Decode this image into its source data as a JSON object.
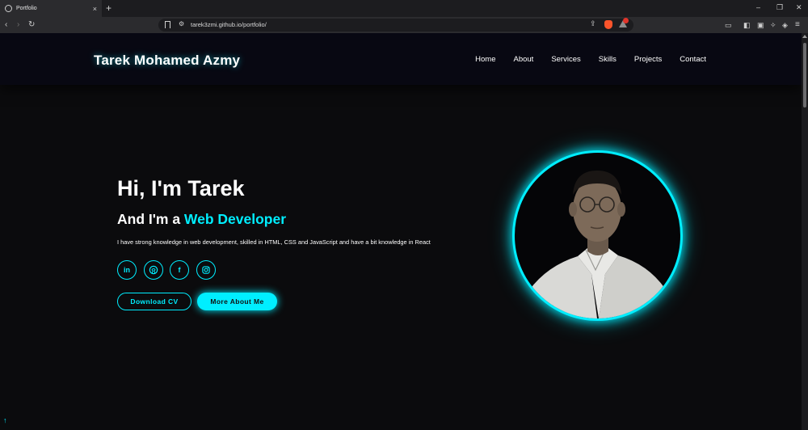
{
  "browser": {
    "tab_title": "Portfolio",
    "tab_close": "×",
    "new_tab": "+",
    "url": "tarek3zmi.github.io/portfolio/",
    "window_controls": [
      "–",
      "❐",
      "✕"
    ]
  },
  "header": {
    "logo": "Tarek Mohamed Azmy",
    "nav": [
      "Home",
      "About",
      "Services",
      "Skills",
      "Projects",
      "Contact"
    ]
  },
  "hero": {
    "greeting": "Hi, I'm Tarek",
    "role_prefix": "And I'm a ",
    "role": "Web Developer",
    "description": "I have strong knowledge in web development, skilled in HTML, CSS and JavaScript and have a bit knowledge in React",
    "socials": [
      "linkedin-icon",
      "github-icon",
      "facebook-icon",
      "instagram-icon"
    ],
    "buttons": {
      "cv": "Download CV",
      "about": "More About Me"
    }
  },
  "colors": {
    "accent": "#00eeff",
    "background": "#0b0b0d",
    "header": "#080812"
  }
}
